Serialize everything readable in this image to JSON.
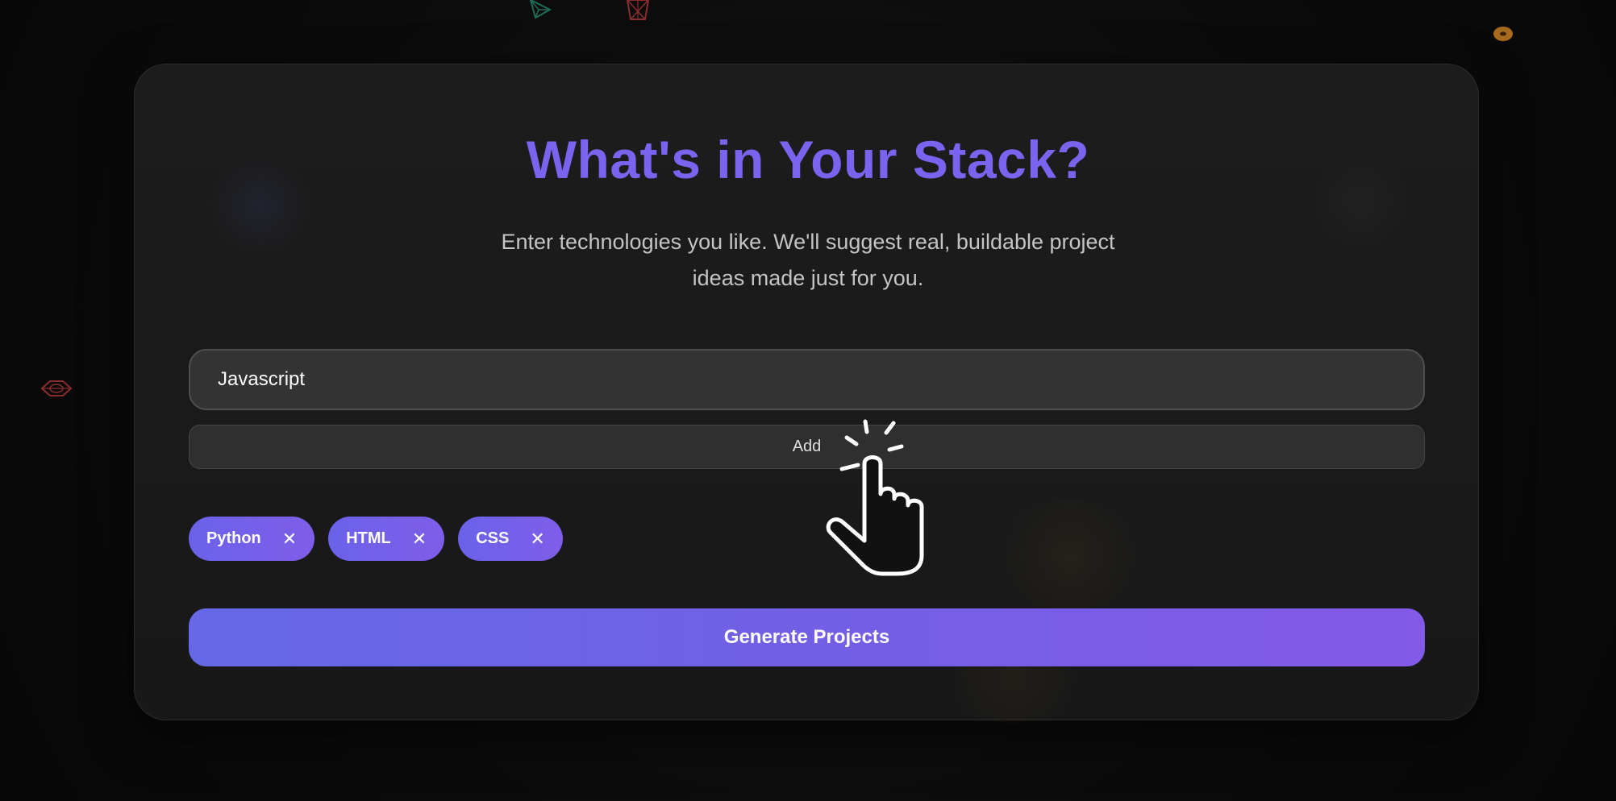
{
  "page": {
    "title": "What's in Your Stack?",
    "subtitle": "Enter technologies you like. We'll suggest real, buildable project ideas made just for you."
  },
  "input": {
    "value": "Javascript"
  },
  "add_button": {
    "label": "Add"
  },
  "tags": [
    {
      "label": "Python",
      "remove": "✕"
    },
    {
      "label": "HTML",
      "remove": "✕"
    },
    {
      "label": "CSS",
      "remove": "✕"
    }
  ],
  "generate_button": {
    "label": "Generate Projects"
  },
  "colors": {
    "accent": "#7a63ee",
    "background": "#0b0b0b",
    "card": "#1b1b1b",
    "gradient_start": "#6569e6",
    "gradient_end": "#835ae8"
  },
  "icons": [
    "pointing-hand-cursor-icon",
    "wireframe-triangle-icon",
    "wireframe-cube-icon",
    "donut-icon",
    "wireframe-eye-icon",
    "close-icon"
  ]
}
